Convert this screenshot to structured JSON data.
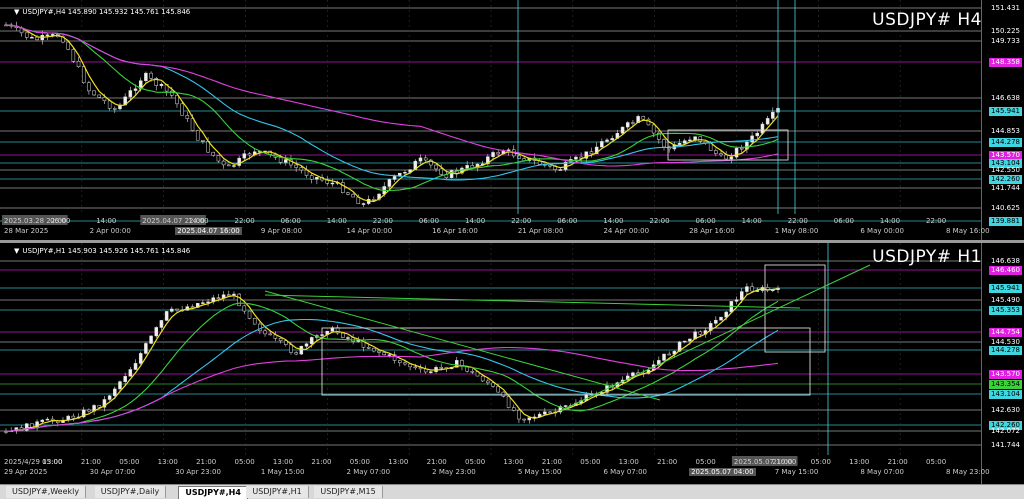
{
  "colors": {
    "background": "#000000",
    "ma_fast": "#f0e020",
    "ma_mid": "#3ad13a",
    "ma_slow": "#33c3e8",
    "ma_long": "#e040e0",
    "level_cyan": "#3fd6e0",
    "level_magenta": "#e020e0",
    "box": "#d8d8d8"
  },
  "top_pane": {
    "info": "USDJPY#,H4  145.890 145.932 145.761 145.846",
    "title": "USDJPY# H4",
    "price_labels": [
      {
        "text": "151.431",
        "style": "plain"
      },
      {
        "text": "150.225",
        "style": "plain"
      },
      {
        "text": "149.733",
        "style": "plain"
      },
      {
        "text": "148.358",
        "style": "magenta"
      },
      {
        "text": "146.638",
        "style": "plain"
      },
      {
        "text": "145.941",
        "style": "cyan"
      },
      {
        "text": "144.853",
        "style": "plain"
      },
      {
        "text": "144.278",
        "style": "cyan"
      },
      {
        "text": "143.570",
        "style": "magenta"
      },
      {
        "text": "143.104",
        "style": "cyan"
      },
      {
        "text": "142.550",
        "style": "plain"
      },
      {
        "text": "142.260",
        "style": "cyan"
      },
      {
        "text": "141.744",
        "style": "plain"
      },
      {
        "text": "140.625",
        "style": "plain"
      },
      {
        "text": "139.881",
        "style": "cyan"
      }
    ],
    "inline_time_labels": [
      "2025.03.28 22:00",
      "06:00",
      "14:00",
      "2025.04.07 22:00",
      "14:00",
      "22:00",
      "06:00",
      "14:00",
      "22:00",
      "06:00",
      "14:00",
      "22:00",
      "06:00",
      "14:00",
      "22:00",
      "06:00",
      "14:00",
      "22:00",
      "06:00",
      "14:00",
      "22:00"
    ],
    "time_labels": [
      "28 Mar 2025",
      "2 Apr 00:00",
      "2025.04.07 16:00",
      "9 Apr 08:00",
      "14 Apr 00:00",
      "16 Apr 16:00",
      "21 Apr 08:00",
      "24 Apr 00:00",
      "28 Apr 16:00",
      "1 May 08:00",
      "6 May 00:00",
      "8 May 16:00"
    ]
  },
  "bottom_pane": {
    "info": "USDJPY#,H1  145.903 145.926 145.761 145.846",
    "title": "USDJPY# H1",
    "price_labels": [
      {
        "text": "146.638",
        "style": "plain"
      },
      {
        "text": "146.460",
        "style": "magenta"
      },
      {
        "text": "145.941",
        "style": "cyan"
      },
      {
        "text": "145.490",
        "style": "plain"
      },
      {
        "text": "145.353",
        "style": "cyan"
      },
      {
        "text": "144.754",
        "style": "magenta"
      },
      {
        "text": "144.530",
        "style": "plain"
      },
      {
        "text": "144.278",
        "style": "cyan"
      },
      {
        "text": "143.570",
        "style": "magenta"
      },
      {
        "text": "143.354",
        "style": "green"
      },
      {
        "text": "143.104",
        "style": "cyan"
      },
      {
        "text": "142.630",
        "style": "plain"
      },
      {
        "text": "142.260",
        "style": "cyan"
      },
      {
        "text": "142.072",
        "style": "plain"
      },
      {
        "text": "141.744",
        "style": "plain"
      }
    ],
    "inline_time_labels": [
      "2025/4/29 05:00",
      "13:00",
      "21:00",
      "05:00",
      "13:00",
      "21:00",
      "05:00",
      "13:00",
      "21:00",
      "05:00",
      "13:00",
      "21:00",
      "05:00",
      "13:00",
      "21:00",
      "05:00",
      "13:00",
      "21:00",
      "05:00",
      "2025.05.07 10:00",
      "21:00",
      "05:00",
      "13:00",
      "21:00",
      "05:00"
    ],
    "time_labels": [
      "29 Apr 2025",
      "30 Apr 07:00",
      "30 Apr 23:00",
      "1 May 15:00",
      "2 May 07:00",
      "2 May 23:00",
      "5 May 15:00",
      "6 May 07:00",
      "2025.05.07 04:00",
      "7 May 15:00",
      "8 May 07:00",
      "8 May 23:00"
    ]
  },
  "tabs": [
    {
      "label": "USDJPY#,Weekly",
      "active": false
    },
    {
      "label": "USDJPY#,Daily",
      "active": false
    },
    {
      "label": "USDJPY#,H4",
      "active": true
    },
    {
      "label": "USDJPY#,H1",
      "active": false
    },
    {
      "label": "USDJPY#,M15",
      "active": false
    }
  ]
}
